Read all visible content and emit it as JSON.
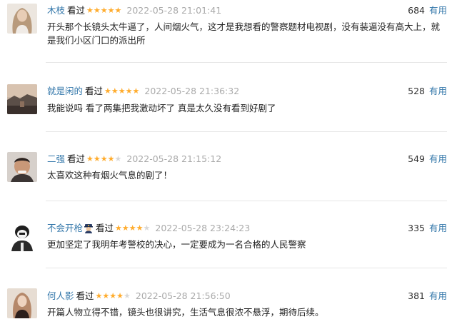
{
  "reviews": [
    {
      "user": "木枝",
      "status": "看过",
      "rating": 5,
      "time": "2022-05-28 21:01:41",
      "votes": "684",
      "useful_label": "有用",
      "content": "开头那个长镜头太牛逼了，人间烟火气，这才是我想看的警察题材电视剧，没有装逼没有高大上，就是我们小区门口的派出所"
    },
    {
      "user": "就是闲的",
      "status": "看过",
      "rating": 5,
      "time": "2022-05-28 21:36:32",
      "votes": "528",
      "useful_label": "有用",
      "content": "我能说吗 看了两集把我激动坏了 真是太久没有看到好剧了"
    },
    {
      "user": "二强",
      "status": "看过",
      "rating": 4,
      "time": "2022-05-28 21:15:12",
      "votes": "549",
      "useful_label": "有用",
      "content": "太喜欢这种有烟火气息的剧了！"
    },
    {
      "user": "不会开枪",
      "status": "看过",
      "rating": 4,
      "time": "2022-05-28 23:24:23",
      "votes": "335",
      "useful_label": "有用",
      "badge": "police-officer-icon",
      "content": "更加坚定了我明年考警校的决心，一定要成为一名合格的人民警察"
    },
    {
      "user": "何人影",
      "status": "看过",
      "rating": 4,
      "time": "2022-05-28 21:56:50",
      "votes": "381",
      "useful_label": "有用",
      "content": "开篇人物立得不错，镜头也很讲究，生活气息很浓不悬浮，期待后续。"
    }
  ],
  "colors": {
    "link": "#3377aa",
    "star_on": "#ffac2d",
    "star_off": "#d8d8d8",
    "time": "#aaaaaa"
  }
}
